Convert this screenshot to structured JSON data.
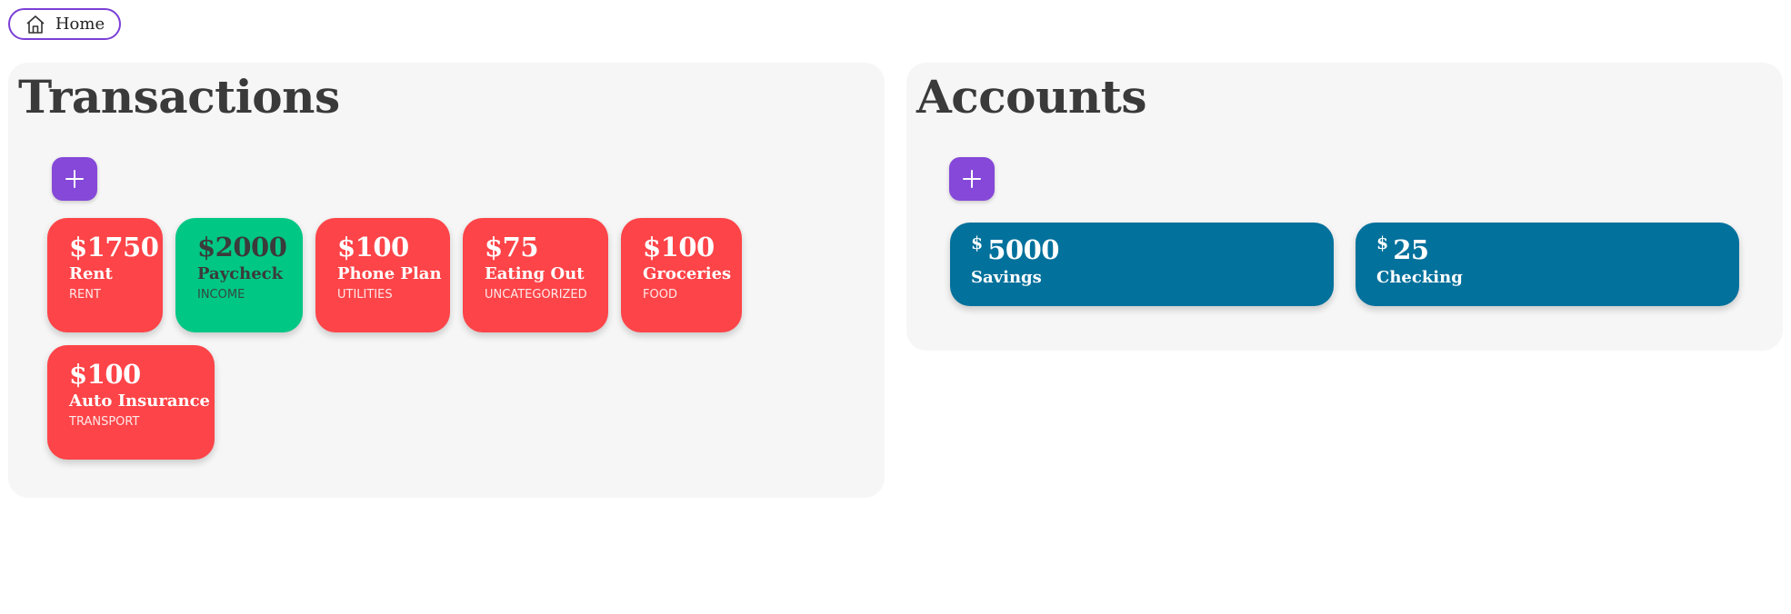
{
  "nav": {
    "home_label": "Home",
    "home_icon": "home-icon"
  },
  "transactions": {
    "title": "Transactions",
    "add_icon": "plus-icon",
    "items": [
      {
        "amount": "$1750",
        "name": "Rent",
        "category": "RENT",
        "type": "expense"
      },
      {
        "amount": "$2000",
        "name": "Paycheck",
        "category": "INCOME",
        "type": "income"
      },
      {
        "amount": "$100",
        "name": "Phone Plan",
        "category": "UTILITIES",
        "type": "expense"
      },
      {
        "amount": "$75",
        "name": "Eating Out",
        "category": "UNCATEGORIZED",
        "type": "expense"
      },
      {
        "amount": "$100",
        "name": "Groceries",
        "category": "FOOD",
        "type": "expense"
      },
      {
        "amount": "$100",
        "name": "Auto Insurance",
        "category": "TRANSPORT",
        "type": "expense"
      }
    ]
  },
  "accounts": {
    "title": "Accounts",
    "add_icon": "plus-icon",
    "items": [
      {
        "currency": "$",
        "amount": "5000",
        "name": "Savings"
      },
      {
        "currency": "$",
        "amount": "25",
        "name": "Checking"
      }
    ]
  },
  "colors": {
    "accent": "#8548d8",
    "home_border": "#7c3fd6",
    "expense": "#fd4448",
    "income": "#00c784",
    "account": "#02719c",
    "panel_bg": "#f6f6f6",
    "title_text": "#3a3a3a"
  }
}
